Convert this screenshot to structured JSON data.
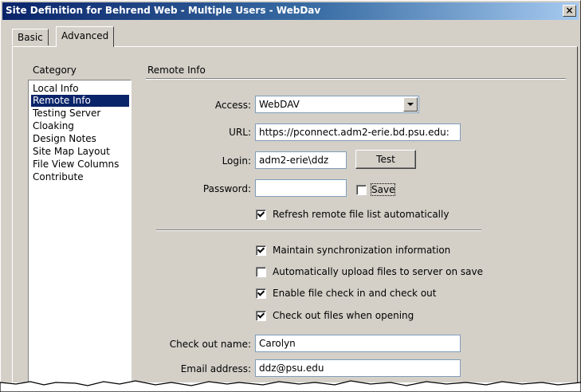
{
  "window": {
    "title": "Site Definition for Behrend Web - Multiple Users - WebDav",
    "close_label": "×"
  },
  "tabs": [
    {
      "label": "Basic",
      "active": false
    },
    {
      "label": "Advanced",
      "active": true
    }
  ],
  "category": {
    "label": "Category",
    "items": [
      {
        "label": "Local Info",
        "selected": false
      },
      {
        "label": "Remote Info",
        "selected": true
      },
      {
        "label": "Testing Server",
        "selected": false
      },
      {
        "label": "Cloaking",
        "selected": false
      },
      {
        "label": "Design Notes",
        "selected": false
      },
      {
        "label": "Site Map Layout",
        "selected": false
      },
      {
        "label": "File View Columns",
        "selected": false
      },
      {
        "label": "Contribute",
        "selected": false
      }
    ]
  },
  "remote": {
    "title": "Remote Info",
    "access_label": "Access:",
    "access_value": "WebDAV",
    "url_label": "URL:",
    "url_value": "https://pconnect.adm2-erie.bd.psu.edu:",
    "login_label": "Login:",
    "login_value": "adm2-erie\\ddz",
    "test_button": "Test",
    "password_label": "Password:",
    "password_value": "",
    "save_label": "Save",
    "save_checked": false,
    "refresh_label": "Refresh remote file list automatically",
    "refresh_checked": true,
    "maintain_sync_label": "Maintain synchronization information",
    "maintain_sync_checked": true,
    "auto_upload_label": "Automatically upload files to server on save",
    "auto_upload_checked": false,
    "checkin_label": "Enable file check in and check out",
    "checkin_checked": true,
    "checkout_open_label": "Check out files when opening",
    "checkout_open_checked": true,
    "checkout_name_label": "Check out name:",
    "checkout_name_value": "Carolyn",
    "email_label": "Email address:",
    "email_value": "ddz@psu.edu"
  },
  "colors": {
    "title_bar": "#0a246a",
    "face": "#d4d0c8",
    "selection": "#0a246a"
  }
}
